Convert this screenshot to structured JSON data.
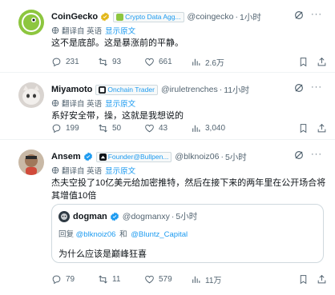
{
  "tweets": [
    {
      "name": "CoinGecko",
      "tag": "Crypto Data Agg...",
      "handle": "@coingecko",
      "time": "1小时",
      "translate_label": "翻译自 英语",
      "translate_link": "显示原文",
      "text": "这不是底部。这是暴涨前的平静。",
      "stats": {
        "replies": "231",
        "retweets": "93",
        "likes": "661",
        "views": "2.6万"
      }
    },
    {
      "name": "Miyamoto",
      "tag": "Onchain Trader",
      "handle": "@iruletrenches",
      "time": "11小时",
      "translate_label": "翻译自 英语",
      "translate_link": "显示原文",
      "text": "系好安全带，操，这就是我想说的",
      "stats": {
        "replies": "199",
        "retweets": "50",
        "likes": "43",
        "views": "3,040"
      }
    },
    {
      "name": "Ansem",
      "tag": "Founder@Bullpen...",
      "handle": "@blknoiz06",
      "time": "5小时",
      "translate_label": "翻译自 英语",
      "translate_link": "显示原文",
      "text": "杰夫空投了10亿美元给加密推特，然后在接下来的两年里在公开场合将其增值10倍",
      "quote": {
        "name": "dogman",
        "handle": "@dogmanxy",
        "time": "5小时",
        "reply_prefix": "回复",
        "reply_to_1": "@blknoiz06",
        "reply_and": "和",
        "reply_to_2": "@Bluntz_Capital",
        "text": "为什么应该是巅峰狂喜"
      },
      "stats": {
        "replies": "79",
        "retweets": "11",
        "likes": "579",
        "views": "11万"
      }
    }
  ],
  "separator": "·",
  "more_label": "···",
  "colors": {
    "accent": "#1d9bf0",
    "muted": "#536471",
    "verified": "#1d9bf0",
    "gold": "#e2b719"
  }
}
